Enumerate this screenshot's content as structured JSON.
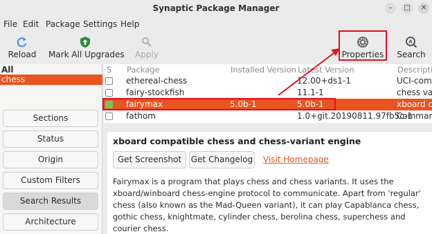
{
  "window": {
    "title": "Synaptic Package Manager"
  },
  "menu": [
    "File",
    "Edit",
    "Package",
    "Settings",
    "Help"
  ],
  "toolbar": {
    "reload": "Reload",
    "mark_all_upgrades": "Mark All Upgrades",
    "apply": "Apply",
    "properties": "Properties",
    "search": "Search"
  },
  "sidebar": {
    "filters": [
      "All",
      "chess"
    ],
    "buttons": [
      "Sections",
      "Status",
      "Origin",
      "Custom Filters",
      "Search Results",
      "Architecture"
    ],
    "active_button": "Search Results"
  },
  "table": {
    "headers": [
      "S",
      "Package",
      "Installed Version",
      "Latest Version",
      "Descripti"
    ],
    "rows": [
      {
        "package": "ethereal-chess",
        "installed": "",
        "latest": "12.00+ds1-1",
        "description": "UCI-compl",
        "installed_state": false,
        "selected": false
      },
      {
        "package": "fairy-stockfish",
        "installed": "",
        "latest": "11.1-1",
        "description": "chess varia",
        "installed_state": false,
        "selected": false
      },
      {
        "package": "fairymax",
        "installed": "5.0b-1",
        "latest": "5.0b-1",
        "description": "xboard co",
        "installed_state": true,
        "selected": true
      },
      {
        "package": "fathom",
        "installed": "",
        "latest": "1.0+git.20190811.97fb5c-1",
        "description": "Command",
        "installed_state": false,
        "selected": false
      }
    ]
  },
  "details": {
    "title": "xboard compatible chess and chess-variant engine",
    "get_screenshot": "Get Screenshot",
    "get_changelog": "Get Changelog",
    "visit_homepage": "Visit Homepage",
    "description_lines": [
      "Fairymax is a program that plays chess and chess variants. It uses the",
      "xboard/winboard chess-engine protocol to communicate. Apart from 'regular'",
      "chess (also known as the Mad-Queen variant), it can play Capablanca chess,",
      "gothic chess, knightmate, cylinder chess, berolina chess, superchess and",
      "courier chess."
    ]
  },
  "colors": {
    "accent": "#e95420",
    "annotation": "#e5101a",
    "installed": "#7cc060"
  }
}
